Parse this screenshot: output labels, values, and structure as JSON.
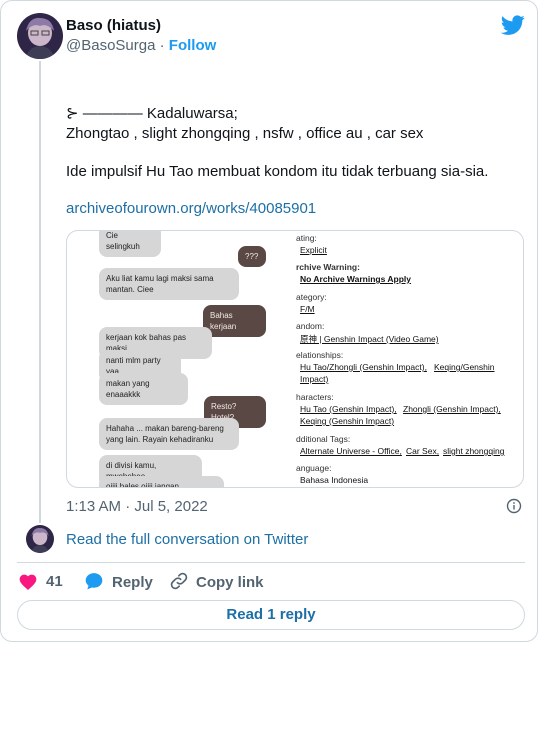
{
  "author": {
    "display_name": "Baso (hiatus)",
    "handle": "@BasoSurga",
    "separator": "·",
    "follow_label": "Follow"
  },
  "tweet": {
    "line1": "⊱ ———— Kadaluwarsa;",
    "line2": "Zhongtao , slight zhongqing , nsfw , office au , car sex",
    "line3": "Ide impulsif Hu Tao membuat kondom itu tidak terbuang sia-sia.",
    "link": "archiveofourown.org/works/40085901"
  },
  "media": {
    "chat": [
      {
        "dir": "in",
        "text": "Cie selingkuh"
      },
      {
        "dir": "out",
        "text": "???"
      },
      {
        "dir": "in",
        "text": "Aku  liat  kamu  lagi  maksi  sama mantan. Ciee"
      },
      {
        "dir": "out",
        "text": "Bahas kerjaan"
      },
      {
        "dir": "in",
        "text": "kerjaan kok bahas pas maksi"
      },
      {
        "dir": "in",
        "text": "nanti mlm party yaa"
      },
      {
        "dir": "in",
        "text": "makan yang enaaakkk"
      },
      {
        "dir": "out",
        "text": "Resto? Hotel?"
      },
      {
        "dir": "in",
        "text": "Hahaha  ...  makan  bareng-bareng yang lain. Rayain kehadiranku"
      },
      {
        "dir": "in",
        "text": "di divisi kamu, mwehehee"
      },
      {
        "dir": "in",
        "text": "oiiii bales oiiii jangan selingkuhh"
      }
    ],
    "meta": {
      "rating_label": "ating:",
      "rating": "Explicit",
      "warning_label": "rchive Warning:",
      "warning": "No Archive Warnings Apply",
      "category_label": "ategory:",
      "category": "F/M",
      "fandom_label": "andom:",
      "fandom": "原神 | Genshin Impact (Video Game)",
      "relationships_label": "elationships:",
      "relationship1": "Hu Tao/Zhongli (Genshin Impact),",
      "relationship2": "Keqing/Genshin",
      "relationship3": "Impact)",
      "characters_label": "haracters:",
      "character1": "Hu Tao (Genshin Impact),",
      "character2": "Zhongli (Genshin Impact),",
      "character3": "Keqing (Genshin Impact)",
      "tags_label": "dditional Tags:",
      "tag1": "Alternate Universe - Office,",
      "tag2": "Car Sex,",
      "tag3": "slight zhongqing",
      "language_label": "anguage:",
      "language": "Bahasa Indonesia"
    }
  },
  "timestamp": "1:13 AM · Jul 5, 2022",
  "read_conversation": "Read the full conversation on Twitter",
  "actions": {
    "like_count": "41",
    "reply_label": "Reply",
    "copy_label": "Copy link"
  },
  "read_replies": "Read 1 reply",
  "colors": {
    "accent": "#1d9bf0",
    "like": "#f91880",
    "link": "#1d6fa5"
  },
  "icons": [
    "twitter-bird-icon",
    "info-icon",
    "heart-icon",
    "reply-icon",
    "link-icon"
  ]
}
